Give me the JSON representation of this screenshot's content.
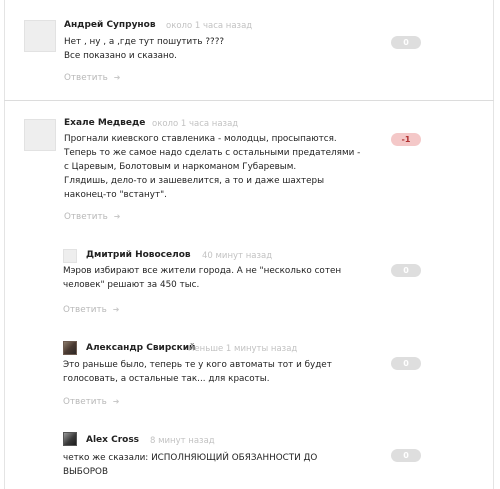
{
  "comments": [
    {
      "author": "Андрей Супрунов",
      "time": "около 1 часа назад",
      "text": "Нет , ну , а ,где тут пошутить ????\nВсе показано и сказано.",
      "reply": "Ответить",
      "score": "0"
    },
    {
      "author": "Exaле Медведе",
      "time": "около 1 часа назад",
      "text": "Прогнали киевского ставленика - молодцы, просыпаются.\nТеперь то же самое надо сделать с остальными предателями -\nс Царевым, Болотовым и наркоманом Губаревым.\nГлядишь, дело-то и зашевелится, а то и даже шахтеры\nнаконец-то \"встанут\".",
      "reply": "Ответить",
      "score": "-1"
    },
    {
      "author": "Дмитрий Новоселов",
      "time": "40 минут назад",
      "text": "Мэров избирают все жители города. А не \"несколько сотен\nчеловек\" решают за 450 тыс.",
      "reply": "Ответить",
      "score": "0"
    },
    {
      "author": "Александр Свирский",
      "time": "меньше 1 минуты назад",
      "text": "Это раньше было, теперь те у кого автоматы тот и будет\nголосовать, а остальные так... для красоты.",
      "reply": "Ответить",
      "score": "0"
    },
    {
      "author": "Alex Cross",
      "time": "8 минут назад",
      "text": "четко же сказали: ИСПОЛНЯЮЩИЙ ОБЯЗАННОСТИ ДО\nВЫБОРОВ",
      "reply": "",
      "score": "0"
    }
  ],
  "icons": {
    "reply": "reply-arrow-icon",
    "avatar_placeholder": "default-avatar-icon",
    "avatar_photo": "user-photo-icon"
  },
  "colors": {
    "neutral_score": "#dedede",
    "negative_score": "#f4c8c8",
    "negative_score_text": "#b03030",
    "muted_text": "#b8b8b8"
  }
}
